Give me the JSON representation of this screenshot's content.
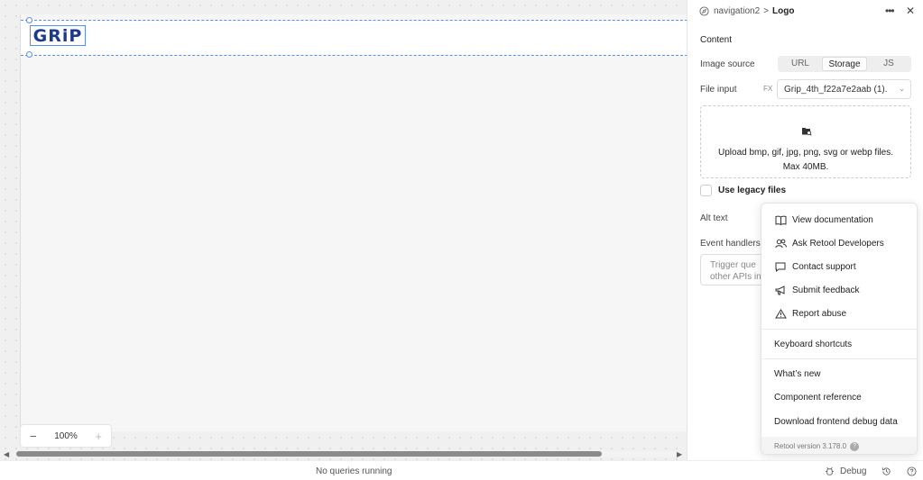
{
  "canvas": {
    "logo_text": "GRiP",
    "zoom": {
      "minus": "−",
      "value": "100%",
      "plus": "+"
    }
  },
  "status_bar": {
    "text": "No queries running",
    "debug_label": "Debug"
  },
  "inspector": {
    "breadcrumb": {
      "component": "navigation2",
      "separator": ">",
      "current": "Logo"
    },
    "section_title": "Content",
    "image_source": {
      "label": "Image source",
      "options": [
        "URL",
        "Storage",
        "JS"
      ],
      "selected": "Storage"
    },
    "file_input": {
      "label": "File input",
      "fx": "FX",
      "value": "Grip_4th_f22a7e2aab (1)."
    },
    "dropzone": {
      "line1": "Upload bmp, gif, jpg, png, svg or webp files.",
      "line2": "Max 40MB."
    },
    "legacy": {
      "label": "Use legacy files"
    },
    "alt_text_label": "Alt text",
    "event_handlers": {
      "label": "Event handlers",
      "placeholder_line1": "Trigger que",
      "placeholder_line2": "other APIs in"
    }
  },
  "help_menu": {
    "items": [
      {
        "label": "View documentation",
        "icon": "book-icon"
      },
      {
        "label": "Ask Retool Developers",
        "icon": "users-icon"
      },
      {
        "label": "Contact support",
        "icon": "chat-icon"
      },
      {
        "label": "Submit feedback",
        "icon": "megaphone-icon"
      },
      {
        "label": "Report abuse",
        "icon": "warning-icon"
      }
    ],
    "shortcuts": "Keyboard shortcuts",
    "links": [
      "What’s new",
      "Component reference",
      "Download frontend debug data"
    ],
    "version": "Retool version 3.178.0"
  },
  "colors": {
    "selection": "#5a8ef0",
    "logo": "#1d3a8a"
  }
}
